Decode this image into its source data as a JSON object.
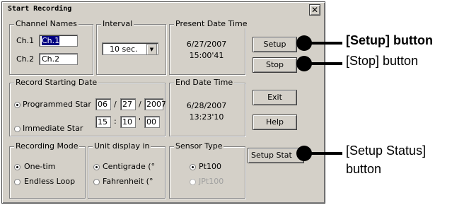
{
  "window": {
    "title": "Start Recording",
    "close_glyph": "✕"
  },
  "channel_names": {
    "legend": "Channel Names",
    "ch1_label": "Ch.1",
    "ch1_value": "Ch.1",
    "ch2_label": "Ch.2",
    "ch2_value": "Ch.2"
  },
  "interval": {
    "legend": "Interval",
    "selected": "10 sec."
  },
  "present_date_time": {
    "legend": "Present Date Time",
    "date": "6/27/2007",
    "time": "15:00'41"
  },
  "record_starting_date": {
    "legend": "Record Starting Date",
    "programmed_label": "Programmed Star",
    "immediate_label": "Immediate Star",
    "programmed_selected": true,
    "month": "06",
    "day": "27",
    "year": "2007",
    "hour": "15",
    "minute": "10",
    "second": "00",
    "date_sep": "/",
    "time_sep1": ":",
    "time_sep2": "'"
  },
  "end_date_time": {
    "legend": "End Date Time",
    "date": "6/28/2007",
    "time": "13:23'10"
  },
  "recording_mode": {
    "legend": "Recording Mode",
    "option1": "One-tim",
    "option2": "Endless Loop",
    "selected": "option1"
  },
  "unit_display": {
    "legend": "Unit display in",
    "option1": "Centigrade (°",
    "option2": "Fahrenheit (°",
    "selected": "option1"
  },
  "sensor_type": {
    "legend": "Sensor Type",
    "option1": "Pt100",
    "option2": "JPt100",
    "selected": "option1"
  },
  "buttons": {
    "setup": "Setup",
    "stop": "Stop",
    "exit": "Exit",
    "help": "Help",
    "setup_status": "Setup Stat"
  },
  "callouts": {
    "setup": "[Setup] button",
    "stop": "[Stop] button",
    "setup_status_line1": "[Setup Status]",
    "setup_status_line2": "button"
  }
}
